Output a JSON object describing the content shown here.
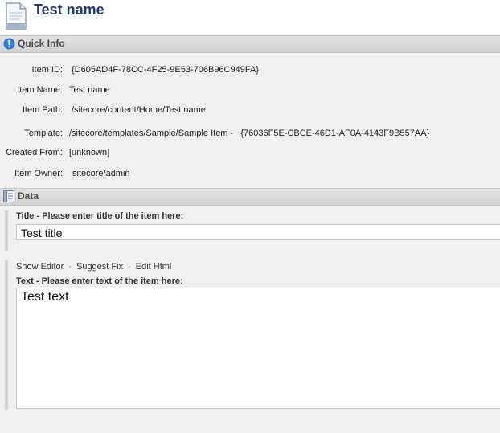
{
  "header": {
    "title": "Test name",
    "icon": "document-icon"
  },
  "quick_info": {
    "section_title": "Quick Info",
    "icon": "info-icon",
    "rows": [
      {
        "label": "Item ID:",
        "value": "{D605AD4F-78CC-4F25-9E53-706B96C949FA}"
      },
      {
        "label": "Item Name:",
        "value": "Test name"
      },
      {
        "label": "Item Path:",
        "value": "/sitecore/content/Home/Test name"
      },
      {
        "label": "Template:",
        "value": "/sitecore/templates/Sample/Sample Item -   {76036F5E-CBCE-46D1-AF0A-4143F9B557AA}"
      },
      {
        "label": "Created From:",
        "value": "[unknown]"
      },
      {
        "label": "Item Owner:",
        "value": "sitecore\\admin"
      }
    ]
  },
  "data_section": {
    "section_title": "Data",
    "icon": "data-icon",
    "title_field": {
      "label": "Title - Please enter title of the item here:",
      "value": "Test title"
    },
    "text_field": {
      "links": [
        "Show Editor",
        "Suggest Fix",
        "Edit Html"
      ],
      "separator": "·",
      "label": "Text - Please enter text of the item here:",
      "value": "Test text"
    }
  },
  "colors": {
    "title": "#1d3d6e",
    "info_icon": "#2a6fc9",
    "background": "#f0f0f0"
  }
}
